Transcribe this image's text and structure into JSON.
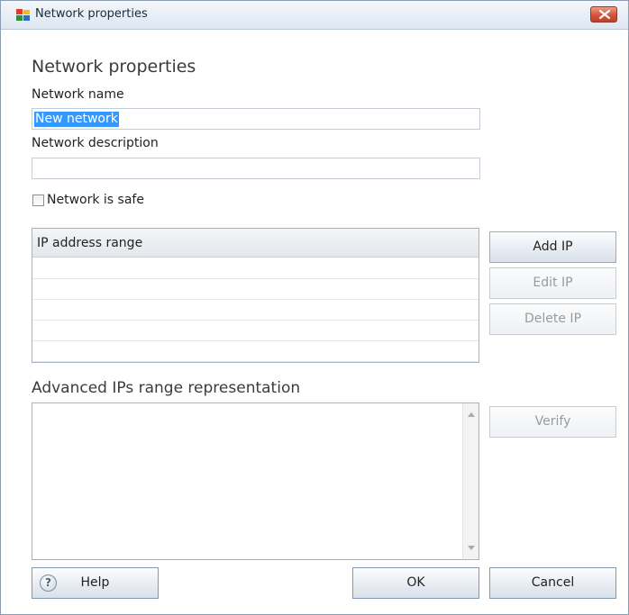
{
  "window": {
    "title": "Network properties"
  },
  "dialog": {
    "heading": "Network properties",
    "network_name_label": "Network name",
    "network_name_value": "New network",
    "network_description_label": "Network description",
    "network_description_value": "",
    "safe_checkbox_label": "Network is safe",
    "safe_checked": false
  },
  "ip_list": {
    "column_header": "IP address range",
    "rows": [
      "",
      "",
      "",
      "",
      ""
    ]
  },
  "buttons": {
    "add_ip": "Add IP",
    "edit_ip": "Edit IP",
    "delete_ip": "Delete IP",
    "verify": "Verify",
    "help": "Help",
    "ok": "OK",
    "cancel": "Cancel"
  },
  "advanced": {
    "label": "Advanced IPs range representation",
    "value": ""
  },
  "icons": {
    "app": "avg-logo-icon",
    "close": "close-icon",
    "help": "help-icon"
  }
}
